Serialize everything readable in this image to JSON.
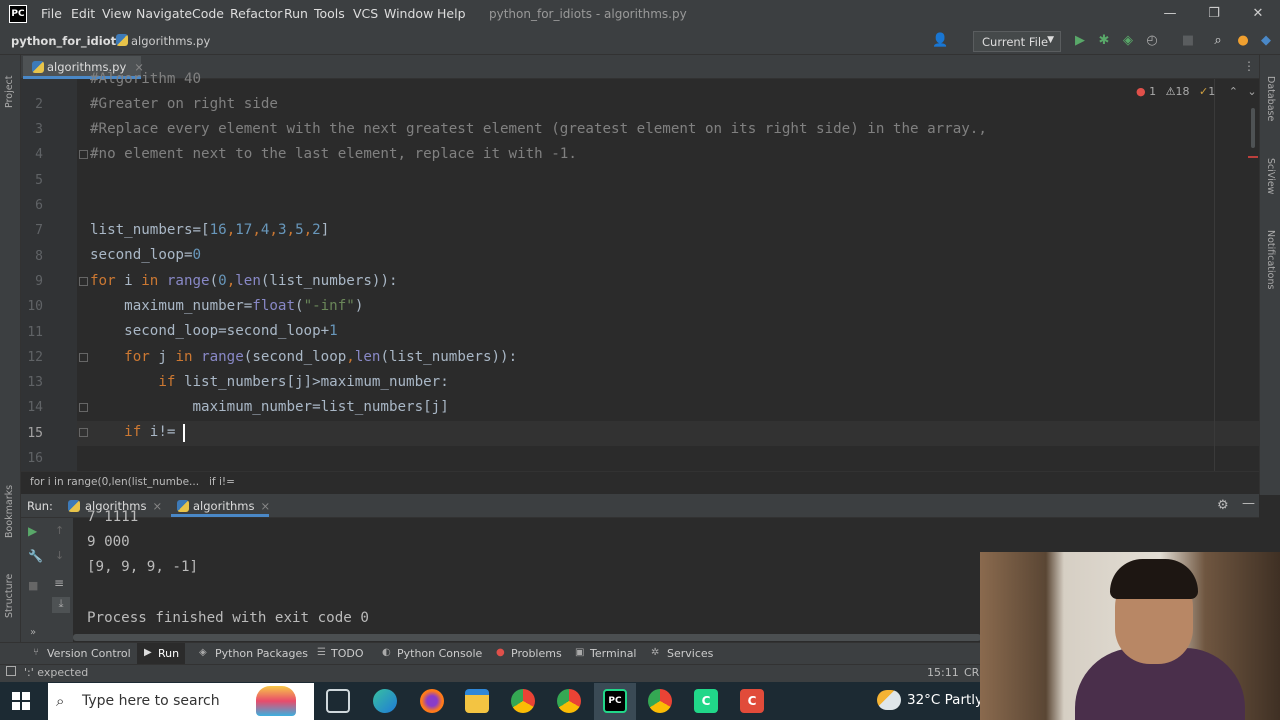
{
  "app": {
    "logo_text": "PC",
    "window_title": "python_for_idiots - algorithms.py",
    "menu": [
      "File",
      "Edit",
      "View",
      "Navigate",
      "Code",
      "Refactor",
      "Run",
      "Tools",
      "VCS",
      "Window",
      "Help"
    ],
    "minimize": "—",
    "maximize": "❐",
    "close": "✕"
  },
  "navbar": {
    "project": "python_for_idiots",
    "file": "algorithms.py",
    "run_config": "Current File"
  },
  "left_strip": {
    "project": "Project",
    "bookmarks": "Bookmarks",
    "structure": "Structure"
  },
  "right_strip": {
    "database": "Database",
    "sciview": "SciView",
    "notifications": "Notifications"
  },
  "editor": {
    "tab_label": "algorithms.py",
    "inspection": {
      "errors": "1",
      "warnings": "18",
      "weak": "1"
    },
    "line_numbers": [
      "2",
      "3",
      "4",
      "5",
      "6",
      "7",
      "8",
      "9",
      "10",
      "11",
      "12",
      "13",
      "14",
      "15",
      "16"
    ],
    "lines": {
      "l1": "#Algorithm 40",
      "l2": "#Greater on right side",
      "l3": "#Replace every element with the next greatest element (greatest element on its right side) in the array.,",
      "l4": "#no element next to the last element, replace it with -1.",
      "l7a": "list_numbers=[",
      "l7b": "16",
      "l7c": ",",
      "l7d": "17",
      "l7e": ",",
      "l7f": "4",
      "l7g": ",",
      "l7h": "3",
      "l7i": ",",
      "l7j": "5",
      "l7k": ",",
      "l7l": "2",
      "l7m": "]",
      "l8a": "second_loop=",
      "l8b": "0",
      "l9a": "for ",
      "l9b": "i ",
      "l9c": "in ",
      "l9d": "range",
      "l9e": "(",
      "l9f": "0",
      "l9g": ",",
      "l9h": "len",
      "l9i": "(list_numbers)):",
      "l10a": "    maximum_number=",
      "l10b": "float",
      "l10c": "(",
      "l10d": "\"-inf\"",
      "l10e": ")",
      "l11a": "    second_loop=second_loop+",
      "l11b": "1",
      "l12a": "    for ",
      "l12b": "j ",
      "l12c": "in ",
      "l12d": "range",
      "l12e": "(second_loop",
      "l12f": ",",
      "l12g": "len",
      "l12h": "(list_numbers)):",
      "l13a": "        if ",
      "l13b": "list_numbers[j]>maximum_number:",
      "l14a": "            maximum_number=list_numbers[j]",
      "l15a": "    if ",
      "l15b": "i!="
    }
  },
  "breadcrumb": [
    "for i in range(0,len(list_numbe...",
    "if i!="
  ],
  "run_panel": {
    "label": "Run:",
    "tabs": [
      "algorithms",
      "algorithms"
    ],
    "output": [
      "7 1111",
      "9 000",
      "[9, 9, 9, -1]",
      "",
      "Process finished with exit code 0"
    ]
  },
  "toolwindows": [
    "Version Control",
    "Run",
    "Python Packages",
    "TODO",
    "Python Console",
    "Problems",
    "Terminal",
    "Services"
  ],
  "status": {
    "message": "':' expected",
    "position": "15:11",
    "encoding": "CRL"
  },
  "taskbar": {
    "search_placeholder": "Type here to search",
    "weather": "32°C  Partly"
  }
}
